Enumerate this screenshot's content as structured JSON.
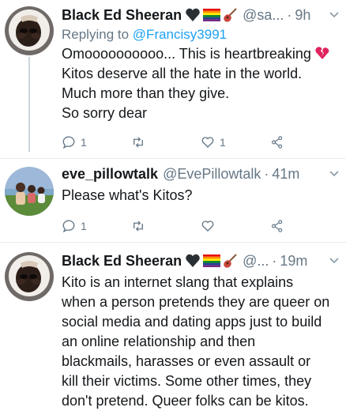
{
  "tweets": [
    {
      "author_name": "Black Ed Sheeran",
      "handle": "@sa...",
      "time": "9h",
      "separator": "·",
      "replying_prefix": "Replying to",
      "replying_to": "@Francisy3991",
      "lines": [
        "Omoooooooooo... This is heartbreaking",
        "Kitos deserve all the hate in the world.",
        "Much more than they give.",
        "So sorry dear"
      ],
      "reply_count": "1",
      "retweet_count": "",
      "like_count": "1"
    },
    {
      "author_name": "eve_pillowtalk",
      "handle": "@EvePillowtalk",
      "time": "41m",
      "separator": "·",
      "lines": [
        "Please what's Kitos?"
      ],
      "reply_count": "1",
      "retweet_count": "",
      "like_count": ""
    },
    {
      "author_name": "Black Ed Sheeran",
      "handle": "@...",
      "time": "19m",
      "separator": "·",
      "lines": [
        "Kito is an internet slang that explains",
        "when a person pretends they are queer on",
        "social media and dating apps just to build",
        "an online relationship and then",
        "blackmails, harasses or even assault or",
        "kill their victims. Some other times, they",
        "don't pretend. Queer folks can be kitos."
      ]
    }
  ],
  "icons": {
    "reply": "reply-icon",
    "retweet": "retweet-icon",
    "like": "heart-icon",
    "share": "share-icon",
    "caret": "chevron-down-icon"
  },
  "colors": {
    "link": "#1da1f2",
    "secondary_text": "#657786",
    "thread_line": "#ccd6dd",
    "broken_heart": "#e0245e"
  }
}
